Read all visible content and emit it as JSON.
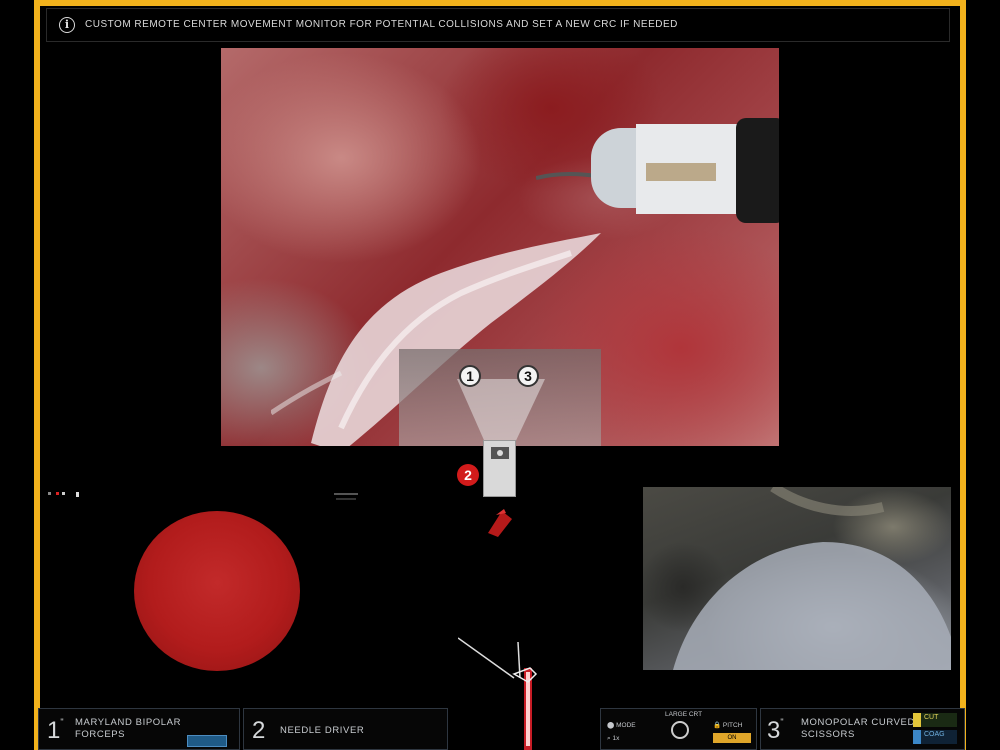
{
  "message_bar": {
    "icon": "info-icon",
    "text": "CUSTOM REMOTE CENTER MOVEMENT  MONITOR FOR POTENTIAL COLLISIONS AND SET A NEW CRC IF NEEDED"
  },
  "nav_overlay": {
    "left_arm": "1",
    "right_arm": "3",
    "active_arm": "2"
  },
  "colors": {
    "frame": "#f2b21c",
    "alert_red": "#d21b1b",
    "ball": "#b21c1c"
  },
  "arm1": {
    "number": "1",
    "tool_line1": "MARYLAND BIPOLAR",
    "tool_line2": "FORCEPS"
  },
  "arm2": {
    "number": "2",
    "tool_line1": "NEEDLE DRIVER"
  },
  "status_panel": {
    "title": "LARGE CRT",
    "left_top": "MODE",
    "left_bottom": "1x",
    "right_top": "PITCH",
    "right_badge": "ON"
  },
  "arm3": {
    "number": "3",
    "tool_line1": "MONOPOLAR CURVED",
    "tool_line2": "SCISSORS",
    "tag_top": "CUT",
    "tag_bottom": "COAG"
  }
}
